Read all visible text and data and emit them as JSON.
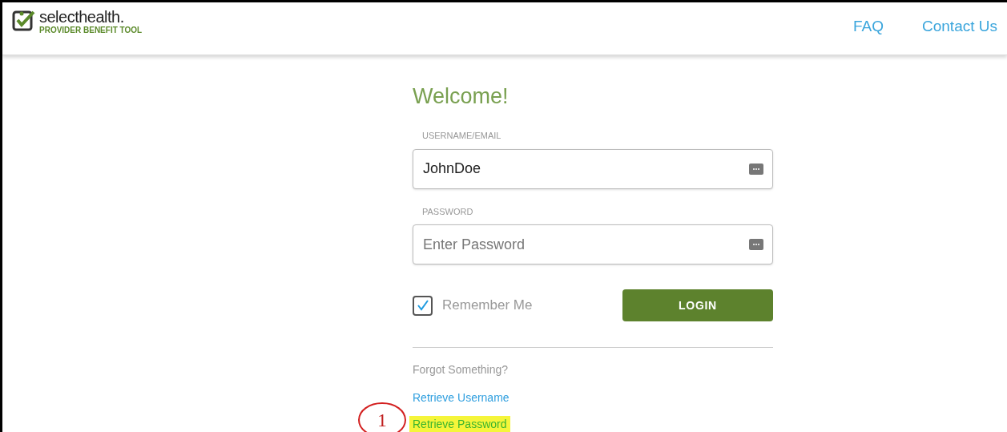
{
  "header": {
    "brand": "selecthealth.",
    "subtitle": "PROVIDER BENEFIT TOOL",
    "nav": [
      "FAQ",
      "Contact Us"
    ]
  },
  "form": {
    "title": "Welcome!",
    "fields": [
      {
        "label": "USERNAME/EMAIL",
        "value": "JohnDoe"
      },
      {
        "label": "PASSWORD",
        "placeholder": "Enter Password"
      }
    ],
    "remember": {
      "label": "Remember Me",
      "checked": true
    },
    "login": "LOGIN",
    "forgot": "Forgot Something?",
    "links": [
      {
        "label": "Retrieve Username",
        "highlighted": false
      },
      {
        "label": "Retrieve Password",
        "highlighted": true
      }
    ]
  },
  "callout": {
    "number": "1"
  }
}
